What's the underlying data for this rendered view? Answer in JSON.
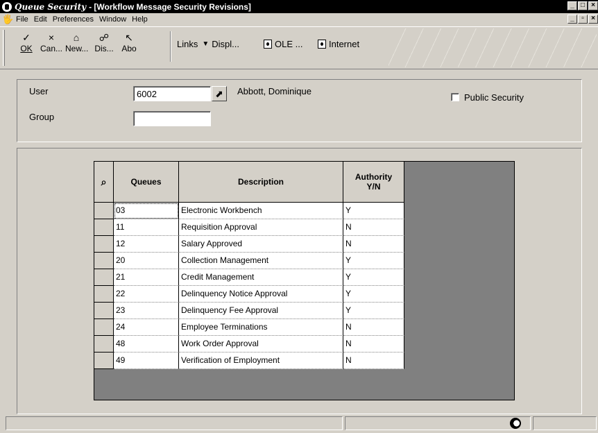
{
  "titlebar": {
    "app_name": "Queue Security",
    "window_title": " - [Workflow Message Security Revisions]"
  },
  "menu": {
    "file": "File",
    "edit": "Edit",
    "preferences": "Preferences",
    "window": "Window",
    "help": "Help"
  },
  "toolbar": {
    "ok": "OK",
    "cancel": "Can...",
    "new": "New...",
    "display": "Dis...",
    "about": "Abo",
    "links": "Links",
    "displ": "Displ...",
    "ole": "OLE ...",
    "internet": "Internet"
  },
  "form": {
    "user_label": "User",
    "user_value": "6002",
    "user_name": "Abbott, Dominique",
    "group_label": "Group",
    "group_value": "",
    "public_security_label": "Public Security",
    "public_security_checked": false
  },
  "grid": {
    "headers": {
      "queues": "Queues",
      "description": "Description",
      "authority_line1": "Authority",
      "authority_line2": "Y/N"
    },
    "rows": [
      {
        "queue": "03",
        "description": "Electronic Workbench",
        "authority": "Y"
      },
      {
        "queue": "11",
        "description": "Requisition Approval",
        "authority": "N"
      },
      {
        "queue": "12",
        "description": "Salary Approved",
        "authority": "N"
      },
      {
        "queue": "20",
        "description": "Collection Management",
        "authority": "Y"
      },
      {
        "queue": "21",
        "description": "Credit Management",
        "authority": "Y"
      },
      {
        "queue": "22",
        "description": "Delinquency Notice Approval",
        "authority": "Y"
      },
      {
        "queue": "23",
        "description": "Delinquency Fee Approval",
        "authority": "Y"
      },
      {
        "queue": "24",
        "description": "Employee Terminations",
        "authority": "N"
      },
      {
        "queue": "48",
        "description": "Work Order Approval",
        "authority": "N"
      },
      {
        "queue": "49",
        "description": "Verification of Employment",
        "authority": "N"
      }
    ]
  }
}
